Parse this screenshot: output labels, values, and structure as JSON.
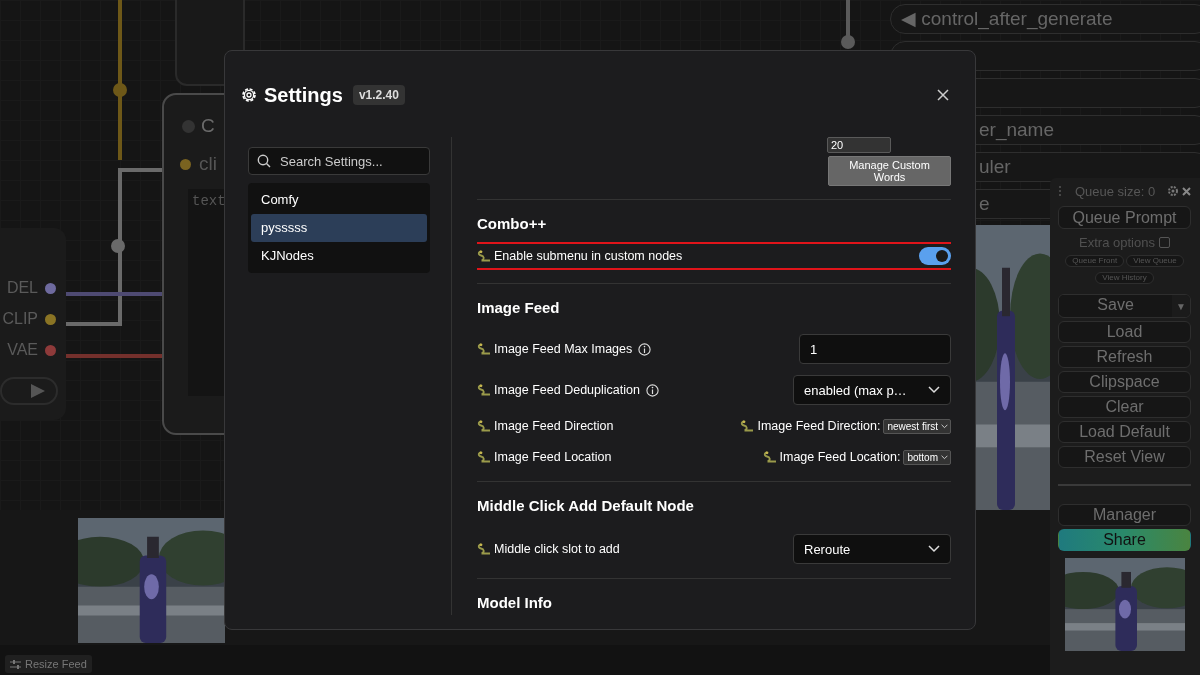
{
  "canvas": {
    "left_node": {
      "outputs": [
        {
          "label": "DEL",
          "color": "#6e6a9e"
        },
        {
          "label": "CLIP",
          "color": "#8a7424"
        },
        {
          "label": "VAE",
          "color": "#8e3a3a"
        }
      ]
    },
    "center_node": {
      "title": "C",
      "input": "cli",
      "placeholder": "text"
    },
    "right_node": {
      "widgets": [
        "◀ control_after_generate",
        "er_name",
        "uler",
        "e"
      ]
    }
  },
  "queue_panel": {
    "queue_size": "Queue size: 0",
    "queue_button": "Queue Prompt",
    "extra_options": {
      "label": "Extra options",
      "checked": false
    },
    "small_buttons": [
      "Queue Front",
      "View Queue",
      "View History"
    ],
    "buttons": [
      {
        "label": "Save",
        "kind": "split",
        "caret": "▼"
      },
      {
        "label": "Load",
        "kind": "plain"
      },
      {
        "label": "Refresh",
        "kind": "plain"
      },
      {
        "label": "Clipspace",
        "kind": "plain"
      },
      {
        "label": "Clear",
        "kind": "plain"
      },
      {
        "label": "Load Default",
        "kind": "plain"
      },
      {
        "label": "Reset View",
        "kind": "plain"
      }
    ],
    "bottom_buttons": [
      {
        "label": "Manager",
        "kind": "plain"
      },
      {
        "label": "Share",
        "kind": "accent"
      }
    ]
  },
  "feed": {
    "resize_button": "Resize Feed"
  },
  "settings": {
    "title": "Settings",
    "version": "v1.2.40",
    "search": {
      "placeholder": "Search Settings..."
    },
    "categories": [
      {
        "label": "Comfy",
        "selected": false
      },
      {
        "label": "pysssss",
        "selected": true
      },
      {
        "label": "KJNodes",
        "selected": false
      }
    ],
    "top_controls": {
      "number_value": "20",
      "button": "Manage Custom Words"
    },
    "sections": [
      {
        "heading": "Combo++",
        "rows": [
          {
            "kind": "toggle",
            "label": "Enable submenu in custom nodes",
            "on": true,
            "highlighted": true
          }
        ]
      },
      {
        "heading": "Image Feed",
        "rows": [
          {
            "kind": "input",
            "label": "Image Feed Max Images",
            "info": true,
            "value": "1"
          },
          {
            "kind": "select",
            "label": "Image Feed Deduplication",
            "info": true,
            "value": "enabled (max p…"
          },
          {
            "kind": "inline-select",
            "label": "Image Feed Direction",
            "inline_label": "Image Feed Direction:",
            "value": "newest first"
          },
          {
            "kind": "inline-select",
            "label": "Image Feed Location",
            "inline_label": "Image Feed Location:",
            "value": "bottom"
          }
        ]
      },
      {
        "heading": "Middle Click Add Default Node",
        "rows": [
          {
            "kind": "select",
            "label": "Middle click slot to add",
            "value": "Reroute"
          }
        ]
      },
      {
        "heading": "Model Info"
      }
    ]
  }
}
